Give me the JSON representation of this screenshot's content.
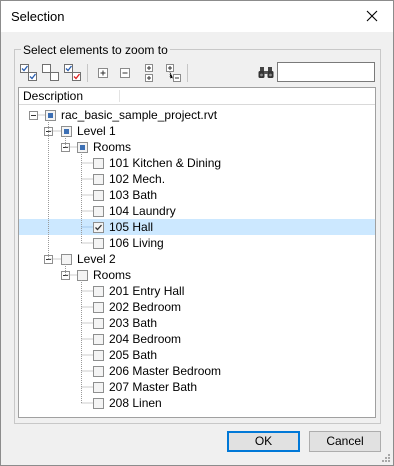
{
  "window": {
    "title": "Selection"
  },
  "group": {
    "label": "Select elements to zoom to"
  },
  "toolbar": {
    "buttons": [
      "check-all-icon",
      "uncheck-all-icon",
      "toggle-check-icon",
      "expand-all-icon",
      "collapse-all-icon",
      "expand-level-icon",
      "collapse-level-icon",
      "binoculars-icon"
    ],
    "search": {
      "value": "",
      "placeholder": ""
    }
  },
  "tree": {
    "column_header": "Description",
    "selected_item": "105 Hall",
    "rows": [
      {
        "label": "rac_basic_sample_project.rvt",
        "state": "partial",
        "expanded": true
      },
      {
        "label": "Level 1",
        "state": "partial",
        "expanded": true
      },
      {
        "label": "Rooms",
        "state": "partial",
        "expanded": true
      },
      {
        "label": "101 Kitchen & Dining",
        "state": "unchecked"
      },
      {
        "label": "102 Mech.",
        "state": "unchecked"
      },
      {
        "label": "103 Bath",
        "state": "unchecked"
      },
      {
        "label": "104 Laundry",
        "state": "unchecked"
      },
      {
        "label": "105 Hall",
        "state": "checked"
      },
      {
        "label": "106 Living",
        "state": "unchecked"
      },
      {
        "label": "Level 2",
        "state": "unchecked",
        "expanded": true
      },
      {
        "label": "Rooms",
        "state": "unchecked",
        "expanded": true
      },
      {
        "label": "201 Entry Hall",
        "state": "unchecked"
      },
      {
        "label": "202 Bedroom",
        "state": "unchecked"
      },
      {
        "label": "203 Bath",
        "state": "unchecked"
      },
      {
        "label": "204 Bedroom",
        "state": "unchecked"
      },
      {
        "label": "205 Bath",
        "state": "unchecked"
      },
      {
        "label": "206 Master Bedroom",
        "state": "unchecked"
      },
      {
        "label": "207 Master Bath",
        "state": "unchecked"
      },
      {
        "label": "208 Linen",
        "state": "unchecked"
      }
    ]
  },
  "buttons": {
    "ok": "OK",
    "cancel": "Cancel"
  },
  "colors": {
    "selection": "#cce8ff",
    "default_button_border": "#0078d7",
    "check_red": "#d22"
  }
}
